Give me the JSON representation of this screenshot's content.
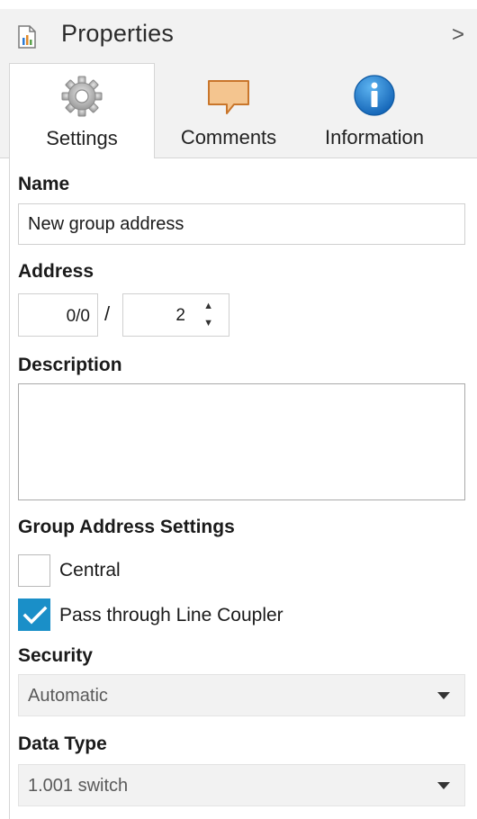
{
  "header": {
    "title": "Properties",
    "collapse_glyph": ">"
  },
  "tabs": [
    {
      "label": "Settings",
      "icon": "gear-icon",
      "active": true
    },
    {
      "label": "Comments",
      "icon": "speech-bubble-icon",
      "active": false
    },
    {
      "label": "Information",
      "icon": "info-icon",
      "active": false
    }
  ],
  "form": {
    "name_label": "Name",
    "name_value": "New group address",
    "address_label": "Address",
    "address_main": "0/0",
    "address_separator": "/",
    "address_sub": "2",
    "description_label": "Description",
    "description_value": "",
    "group_settings_label": "Group Address Settings",
    "central_label": "Central",
    "central_checked": false,
    "pass_through_label": "Pass through Line Coupler",
    "pass_through_checked": true,
    "security_label": "Security",
    "security_value": "Automatic",
    "data_type_label": "Data Type",
    "data_type_value": "1.001 switch"
  },
  "colors": {
    "accent": "#1a8fc8",
    "header_bg": "#f2f2f2",
    "comment_icon": "#f4c58f",
    "info_icon": "#1b7fd1"
  }
}
